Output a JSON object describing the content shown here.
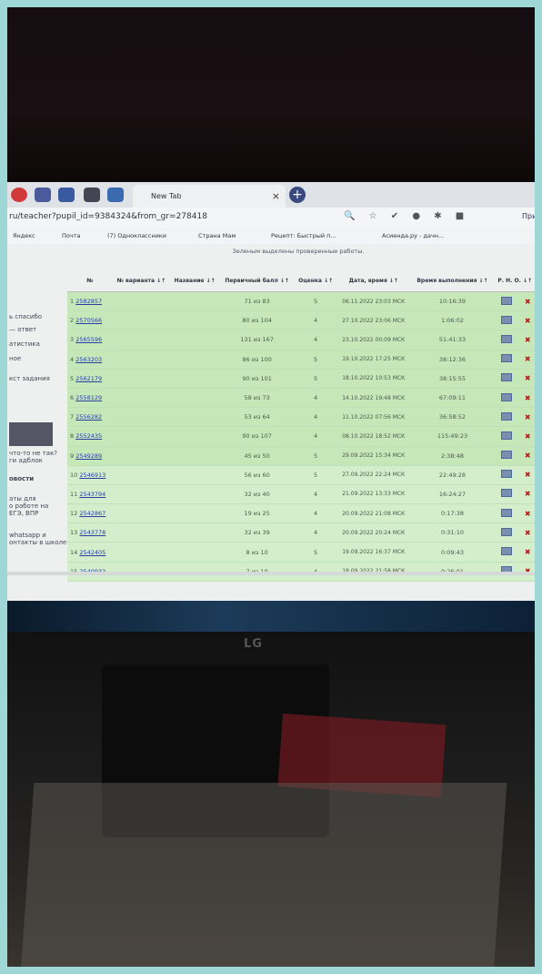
{
  "browser": {
    "tab_title": "New Tab",
    "url": "ru/teacher?pupil_id=9384324&from_gr=278418",
    "profile_label": "При"
  },
  "bookmarks": [
    "Яндекс",
    "Почта",
    "(7) Одноклассники",
    "Страна Мам",
    "Рецепт: Быстрый п...",
    "Асиенда.ру - дачн..."
  ],
  "sidebar": {
    "items": [
      "ь спасибо",
      "— ответ",
      "атистика",
      "ное",
      "кст задания",
      "что-то не так?",
      "ги адблок",
      "овости",
      "аты для",
      "о работе на",
      "ЕГЭ, ВПР",
      "whatsapp и",
      "онтакты в школе"
    ]
  },
  "page": {
    "note": "Зеленым выделены проверенные работы."
  },
  "table": {
    "headers": {
      "no": "№",
      "variant": "№ варианта ↓↑",
      "name": "Название ↓↑",
      "score": "Первичный балл ↓↑",
      "grade": "Оценка ↓↑",
      "date": "Дата, время ↓↑",
      "duration": "Время выполнения ↓↑",
      "rno": "Р. Н. О. ↓↑"
    },
    "rows": [
      {
        "no": "1",
        "variant": "2582857",
        "score": "71 из 83",
        "grade": "5",
        "date": "06.11.2022 23:03 МСК",
        "duration": "10:16:39"
      },
      {
        "no": "2",
        "variant": "2570566",
        "score": "80 из 104",
        "grade": "4",
        "date": "27.10.2022 23:06 МСК",
        "duration": "1:06:02"
      },
      {
        "no": "3",
        "variant": "2565596",
        "score": "131 из 167",
        "grade": "4",
        "date": "23.10.2022 00:09 МСК",
        "duration": "51:41:33"
      },
      {
        "no": "4",
        "variant": "2563203",
        "score": "86 из 100",
        "grade": "5",
        "date": "19.10.2022 17:25 МСК",
        "duration": "38:12:36"
      },
      {
        "no": "5",
        "variant": "2562179",
        "score": "90 из 101",
        "grade": "5",
        "date": "18.10.2022 10:53 МСК",
        "duration": "38:15:55"
      },
      {
        "no": "6",
        "variant": "2558129",
        "score": "58 из 73",
        "grade": "4",
        "date": "14.10.2022 19:48 МСК",
        "duration": "67:09:11"
      },
      {
        "no": "7",
        "variant": "2556282",
        "score": "53 из 64",
        "grade": "4",
        "date": "11.10.2022 07:56 МСК",
        "duration": "36:58:52"
      },
      {
        "no": "8",
        "variant": "2552435",
        "score": "90 из 107",
        "grade": "4",
        "date": "08.10.2022 18:52 МСК",
        "duration": "115:49:23"
      },
      {
        "no": "9",
        "variant": "2549289",
        "score": "45 из 50",
        "grade": "5",
        "date": "29.09.2022 15:34 МСК",
        "duration": "2:38:48"
      },
      {
        "no": "10",
        "variant": "2546913",
        "score": "56 из 60",
        "grade": "5",
        "date": "27.09.2022 22:24 МСК",
        "duration": "22:49:28"
      },
      {
        "no": "11",
        "variant": "2543794",
        "score": "32 из 40",
        "grade": "4",
        "date": "21.09.2022 13:33 МСК",
        "duration": "16:24:27"
      },
      {
        "no": "12",
        "variant": "2542867",
        "score": "19 из 25",
        "grade": "4",
        "date": "20.09.2022 21:08 МСК",
        "duration": "0:17:38"
      },
      {
        "no": "13",
        "variant": "2543778",
        "score": "32 из 39",
        "grade": "4",
        "date": "20.09.2022 20:24 МСК",
        "duration": "0:31:10"
      },
      {
        "no": "14",
        "variant": "2542405",
        "score": "8 из 10",
        "grade": "5",
        "date": "19.09.2022 16:37 МСК",
        "duration": "0:09:43"
      },
      {
        "no": "15",
        "variant": "2540932",
        "score": "7 из 10",
        "grade": "4",
        "date": "18.09.2022 21:58 МСК",
        "duration": "0:26:01"
      }
    ]
  },
  "monitor": {
    "brand": "LG"
  },
  "colors": {
    "checked_row": "#c6e8b8",
    "delete": "#c01818",
    "frame": "#9fd6d6"
  }
}
